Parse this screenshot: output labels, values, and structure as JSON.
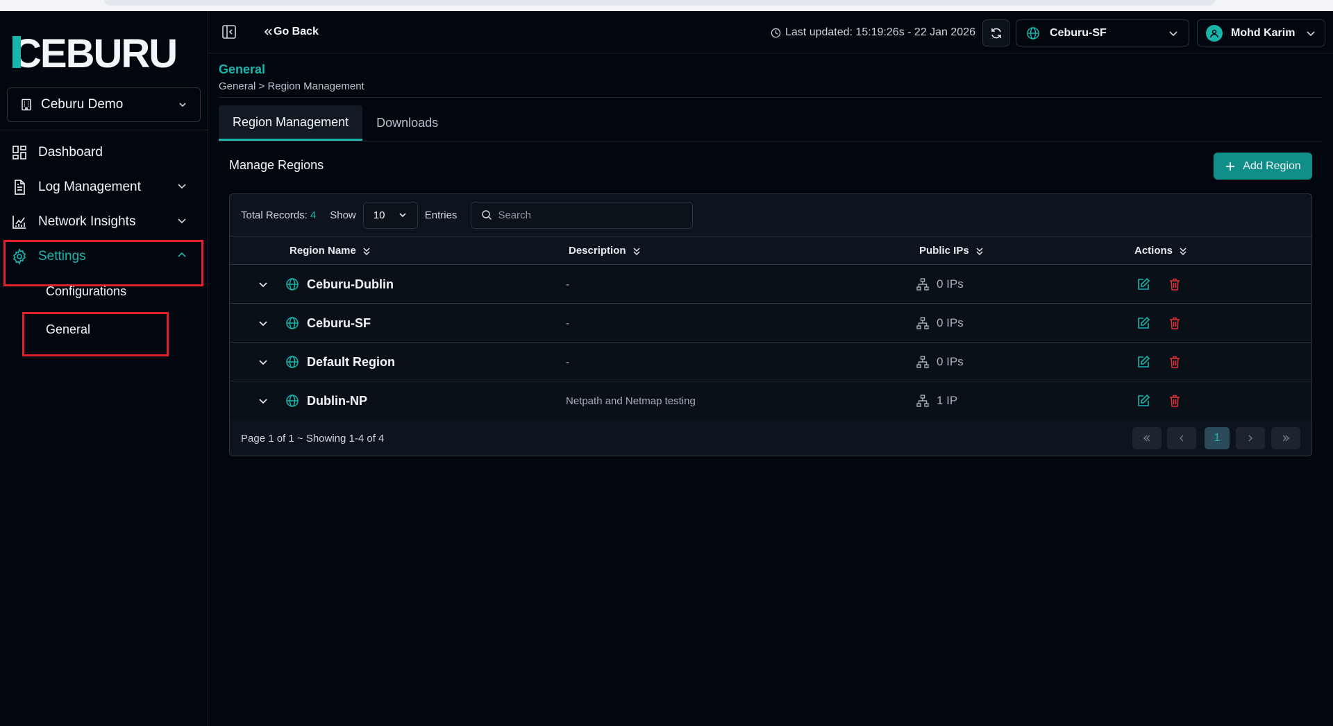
{
  "app": {
    "logo_text": "CEBURU"
  },
  "sidebar": {
    "org": "Ceburu Demo",
    "items": [
      {
        "label": "Dashboard"
      },
      {
        "label": "Log Management"
      },
      {
        "label": "Network Insights"
      },
      {
        "label": "Settings"
      }
    ],
    "sub_items": [
      {
        "label": "Configurations"
      },
      {
        "label": "General"
      }
    ]
  },
  "header": {
    "go_back": "Go Back",
    "last_updated": "Last updated: 15:19:26s - 22 Jan 2026",
    "region": "Ceburu-SF",
    "user": "Mohd Karim"
  },
  "page": {
    "title": "General",
    "breadcrumb": "General > Region Management",
    "tabs": [
      {
        "label": "Region Management"
      },
      {
        "label": "Downloads"
      }
    ],
    "section_title": "Manage Regions",
    "add_button": "Add Region"
  },
  "table": {
    "total_label": "Total Records:",
    "total": "4",
    "show_label": "Show",
    "entries_value": "10",
    "entries_label": "Entries",
    "search_placeholder": "Search",
    "columns": [
      "Region Name",
      "Description",
      "Public IPs",
      "Actions"
    ],
    "rows": [
      {
        "name": "Ceburu-Dublin",
        "description": "-",
        "ips": "0 IPs"
      },
      {
        "name": "Ceburu-SF",
        "description": "-",
        "ips": "0 IPs"
      },
      {
        "name": "Default Region",
        "description": "-",
        "ips": "0 IPs"
      },
      {
        "name": "Dublin-NP",
        "description": "Netpath and Netmap testing",
        "ips": "1 IP"
      }
    ],
    "footer": "Page 1 of 1 ~ Showing 1-4 of 4",
    "current_page": "1"
  },
  "colors": {
    "accent": "#19b5ad",
    "danger": "#e0303a",
    "background": "#02070f"
  }
}
